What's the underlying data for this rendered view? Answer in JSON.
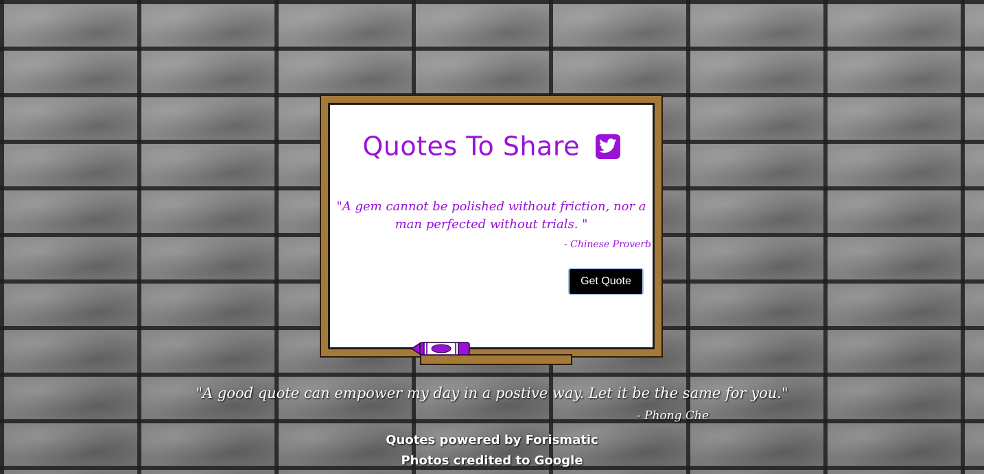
{
  "board": {
    "title": "Quotes To Share",
    "twitter_icon": "twitter-icon",
    "quote": "\"A gem cannot be polished without friction, nor a man perfected without trials. \"",
    "author": "- Chinese Proverb",
    "button_label": "Get Quote"
  },
  "footer": {
    "quote": "\"A good quote can empower my day in a postive way. Let it be the same for you.\"",
    "author": "- Phong Che",
    "credit_quotes": "Quotes powered by Forismatic",
    "credit_photos": "Photos credited to Google"
  },
  "colors": {
    "accent": "#9a12d8",
    "frame": "#a57a38",
    "button_bg": "#000000"
  }
}
